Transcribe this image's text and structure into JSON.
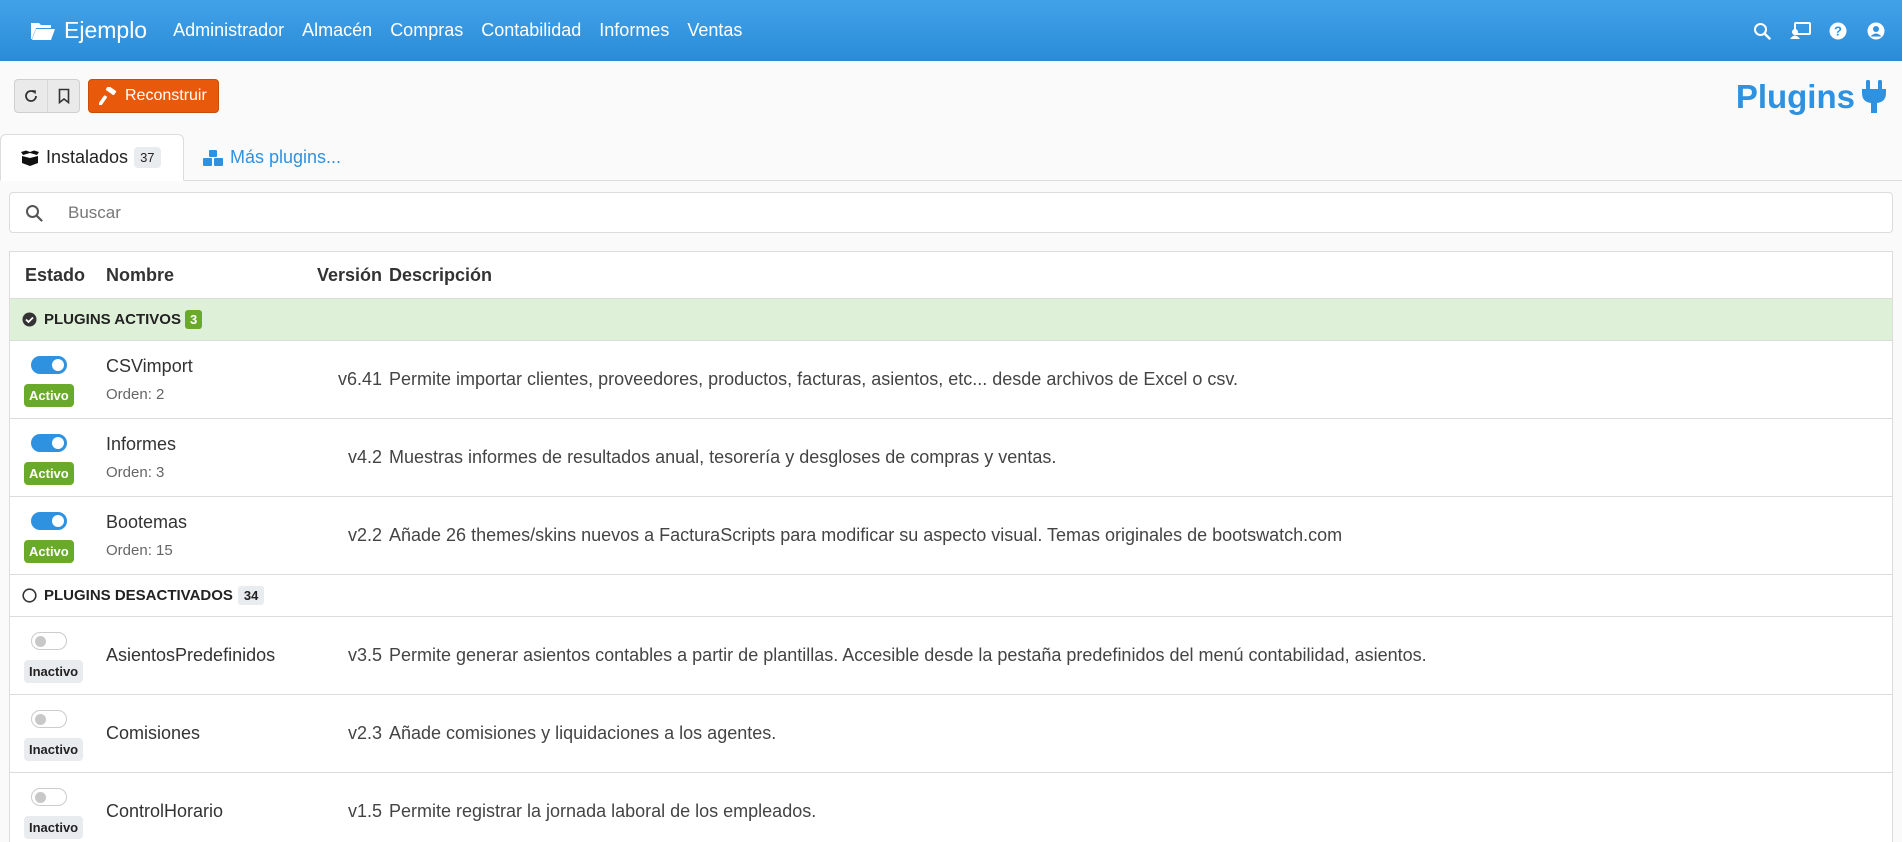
{
  "navbar": {
    "brand": "Ejemplo",
    "items": [
      "Administrador",
      "Almacén",
      "Compras",
      "Contabilidad",
      "Informes",
      "Ventas"
    ],
    "icons": [
      "search-icon",
      "user-switch-icon",
      "help-icon",
      "user-icon"
    ]
  },
  "toolbar": {
    "rebuild_label": "Reconstruir"
  },
  "page": {
    "title": "Plugins"
  },
  "tabs": [
    {
      "label": "Instalados",
      "count": "37"
    },
    {
      "label": "Más plugins..."
    }
  ],
  "search": {
    "placeholder": "Buscar"
  },
  "table": {
    "headers": {
      "estado": "Estado",
      "nombre": "Nombre",
      "version": "Versión",
      "descripcion": "Descripción"
    },
    "active_group": {
      "label": "Plugins activos",
      "count": "3"
    },
    "inactive_group": {
      "label": "Plugins desactivados",
      "count": "34"
    },
    "active_plugins": [
      {
        "status": "Activo",
        "name": "CSVimport",
        "order": "Orden: 2",
        "version": "v6.41",
        "description": "Permite importar clientes, proveedores, productos, facturas, asientos, etc... desde archivos de Excel o csv."
      },
      {
        "status": "Activo",
        "name": "Informes",
        "order": "Orden: 3",
        "version": "v4.2",
        "description": "Muestras informes de resultados anual, tesorería y desgloses de compras y ventas."
      },
      {
        "status": "Activo",
        "name": "Bootemas",
        "order": "Orden: 15",
        "version": "v2.2",
        "description": "Añade 26 themes/skins nuevos a FacturaScripts para modificar su aspecto visual. Temas originales de bootswatch.com"
      }
    ],
    "inactive_plugins": [
      {
        "status": "Inactivo",
        "name": "AsientosPredefinidos",
        "version": "v3.5",
        "description": "Permite generar asientos contables a partir de plantillas. Accesible desde la pestaña predefinidos del menú contabilidad, asientos."
      },
      {
        "status": "Inactivo",
        "name": "Comisiones",
        "version": "v2.3",
        "description": "Añade comisiones y liquidaciones a los agentes."
      },
      {
        "status": "Inactivo",
        "name": "ControlHorario",
        "version": "v1.5",
        "description": "Permite registrar la jornada laboral de los empleados."
      }
    ]
  }
}
